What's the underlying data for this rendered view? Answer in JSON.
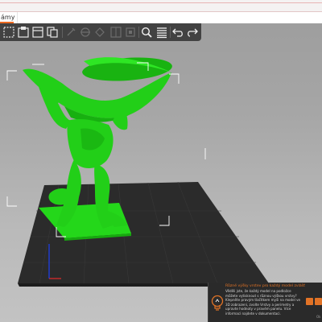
{
  "window": {
    "tab_label": "ámy"
  },
  "toolbar": {
    "buttons": [
      {
        "name": "add",
        "enabled": true
      },
      {
        "name": "arrange",
        "enabled": true
      },
      {
        "name": "copy",
        "enabled": true
      },
      {
        "name": "paste",
        "enabled": true
      },
      {
        "name": "delete",
        "enabled": false
      },
      {
        "name": "delete-all",
        "enabled": false
      },
      {
        "name": "split-objects",
        "enabled": false
      },
      {
        "name": "split-parts",
        "enabled": false
      },
      {
        "name": "search",
        "enabled": true
      },
      {
        "name": "layers",
        "enabled": true
      },
      {
        "name": "undo",
        "enabled": true
      },
      {
        "name": "redo",
        "enabled": true
      }
    ]
  },
  "colors": {
    "toolbar_bg": "#424242",
    "accent": "#ed6b21",
    "model": "#1fcc16",
    "bed": "#2b2b2b",
    "notification_bg": "#2a2a2a"
  },
  "notification": {
    "title": "Různé výšky vrstev pro každý model zvlášť",
    "body": "Věděli jste, že každý model na podložce můžete vytisknout s různou výškou vrstvy? Klepněte pravým tlačítkem myši na model ve 3D zobrazení, zvolte Vrstvy a perimetry a upravte hodnoty v pravém panelu. Více informací najdete v dokumentaci.",
    "link": "Ok",
    "icon": "lightbulb-icon"
  }
}
